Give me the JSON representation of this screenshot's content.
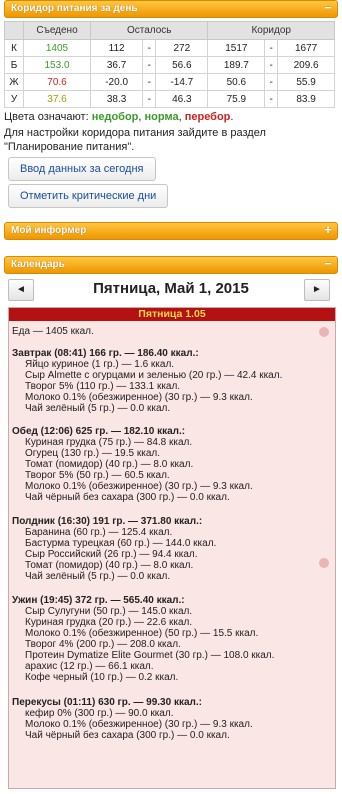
{
  "corridor": {
    "title": "Коридор питания за день",
    "collapse_glyph": "−",
    "columns": [
      "",
      "Съедено",
      "Осталось",
      "Коридор"
    ],
    "rows": [
      {
        "letter": "К",
        "eaten": "1405",
        "eaten_color": "#3b9a2a",
        "left_a": "112",
        "left_b": "272",
        "corr_a": "1517",
        "corr_b": "1677"
      },
      {
        "letter": "Б",
        "eaten": "153.0",
        "eaten_color": "#3b9a2a",
        "left_a": "36.7",
        "left_b": "56.6",
        "corr_a": "189.7",
        "corr_b": "209.6"
      },
      {
        "letter": "Ж",
        "eaten": "70.6",
        "eaten_color": "#cc2222",
        "left_a": "-20.0",
        "left_b": "-14.7",
        "corr_a": "50.6",
        "corr_b": "55.9"
      },
      {
        "letter": "У",
        "eaten": "37.6",
        "eaten_color": "#a0a000",
        "left_a": "38.3",
        "left_b": "46.3",
        "corr_a": "75.9",
        "corr_b": "83.9"
      }
    ],
    "dash": "-",
    "legend_prefix": "Цвета означают:",
    "legend_under": "недобор",
    "legend_norm": "норма",
    "legend_over": "перебор",
    "legend_comma": ",",
    "legend_end": ".",
    "info": "Для настройки коридора питания зайдите в раздел \"Планирование питания\".",
    "btn_enter": "Ввод данных за сегодня",
    "btn_critical": "Отметить критические дни"
  },
  "informer": {
    "title": "Мой информер",
    "expand_glyph": "+"
  },
  "calendar": {
    "title": "Календарь",
    "collapse_glyph": "−",
    "prev_glyph": "◄",
    "next_glyph": "►",
    "date": "Пятница, Май 1, 2015",
    "day_label": "Пятница 1.05",
    "food_total": "Еда — 1405 ккал.",
    "meals": [
      {
        "title": "Завтрак (08:41) 166 гр. — 186.40 ккал.:",
        "items": [
          "Яйцо куриное (1 гр.) — 1.6 ккал.",
          "Сыр Almette с огурцами и зеленью (20 гр.) — 42.4 ккал.",
          "Творог 5% (110 гр.) — 133.1 ккал.",
          "Молоко 0.1% (обезжиренное) (30 гр.) — 9.3 ккал.",
          "Чай зелёный (5 гр.) — 0.0 ккал."
        ]
      },
      {
        "title": "Обед (12:06) 625 гр. — 182.10 ккал.:",
        "items": [
          "Куриная грудка (75 гр.) — 84.8 ккал.",
          "Огурец (130 гр.) — 19.5 ккал.",
          "Томат (помидор) (40 гр.) — 8.0 ккал.",
          "Творог 5% (50 гр.) — 60.5 ккал.",
          "Молоко 0.1% (обезжиренное) (30 гр.) — 9.3 ккал.",
          "Чай чёрный без сахара (300 гр.) — 0.0 ккал."
        ]
      },
      {
        "title": "Полдник (16:30) 191 гр. — 371.80 ккал.:",
        "items": [
          "Баранина (60 гр.) — 125.4 ккал.",
          "Бастурма турецкая (60 гр.) — 144.0 ккал.",
          "Сыр Российский (26 гр.) — 94.4 ккал.",
          "Томат (помидор) (40 гр.) — 8.0 ккал.",
          "Чай зелёный (5 гр.) — 0.0 ккал."
        ]
      },
      {
        "title": "Ужин (19:45) 372 гр. — 565.40 ккал.:",
        "items": [
          "Сыр Сулугуни (50 гр.) — 145.0 ккал.",
          "Куриная грудка (20 гр.) — 22.6 ккал.",
          "Молоко 0.1% (обезжиренное) (50 гр.) — 15.5 ккал.",
          "Творог 4% (200 гр.) — 208.0 ккал.",
          "Протеин Dymatize Elite Gourmet (30 гр.) — 108.0 ккал.",
          "арахис (12 гр.) — 66.1 ккал.",
          "Кофе черный (10 гр.) — 0.2 ккал."
        ]
      },
      {
        "title": "Перекусы (01:11) 630 гр. — 99.30 ккал.:",
        "items": [
          "кефир 0% (300 гр.) — 90.0 ккал.",
          "Молоко 0.1% (обезжиренное) (30 гр.) — 9.3 ккал.",
          "Чай чёрный без сахара (300 гр.) — 0.0 ккал."
        ]
      }
    ]
  }
}
